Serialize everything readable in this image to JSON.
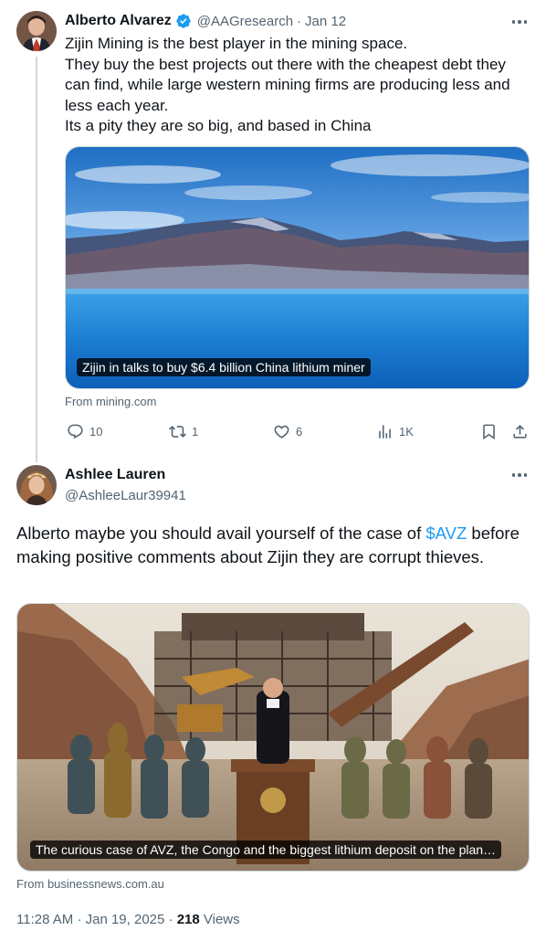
{
  "tweet1": {
    "author": "Alberto Alvarez",
    "handle": "@AAGresearch",
    "separator": "·",
    "date": "Jan 12",
    "lines": [
      "Zijin Mining is the best player in the mining space.",
      "They buy the best projects out there with the cheapest debt they can find, while large western mining firms are producing less and less each year.",
      "Its a pity they are so big, and based in China"
    ],
    "card": {
      "caption": "Zijin in talks to buy $6.4 billion China lithium miner",
      "source": "From mining.com"
    },
    "actions": {
      "replies": "10",
      "reposts": "1",
      "likes": "6",
      "views": "1K"
    }
  },
  "tweet2": {
    "author": "Ashlee Lauren",
    "handle": "@AshleeLaur39941",
    "text_before": "Alberto maybe you should avail yourself of the case of ",
    "cashtag": "$AVZ",
    "text_after": " before making positive comments about Zijin they are corrupt thieves.",
    "card": {
      "caption": "The curious case of AVZ, the Congo and the biggest lithium deposit on the plan…",
      "source": "From businessnews.com.au"
    },
    "time": "11:28 AM",
    "date": "Jan 19, 2025",
    "separator": "·",
    "views_count": "218",
    "views_label": " Views"
  },
  "colors": {
    "accent": "#1d9bf0",
    "muted": "#536471",
    "text": "#0f1419",
    "border": "#cfd9de"
  },
  "icons": [
    "verified-badge-icon",
    "more-icon",
    "reply-icon",
    "repost-icon",
    "like-icon",
    "views-icon",
    "bookmark-icon",
    "share-icon"
  ]
}
